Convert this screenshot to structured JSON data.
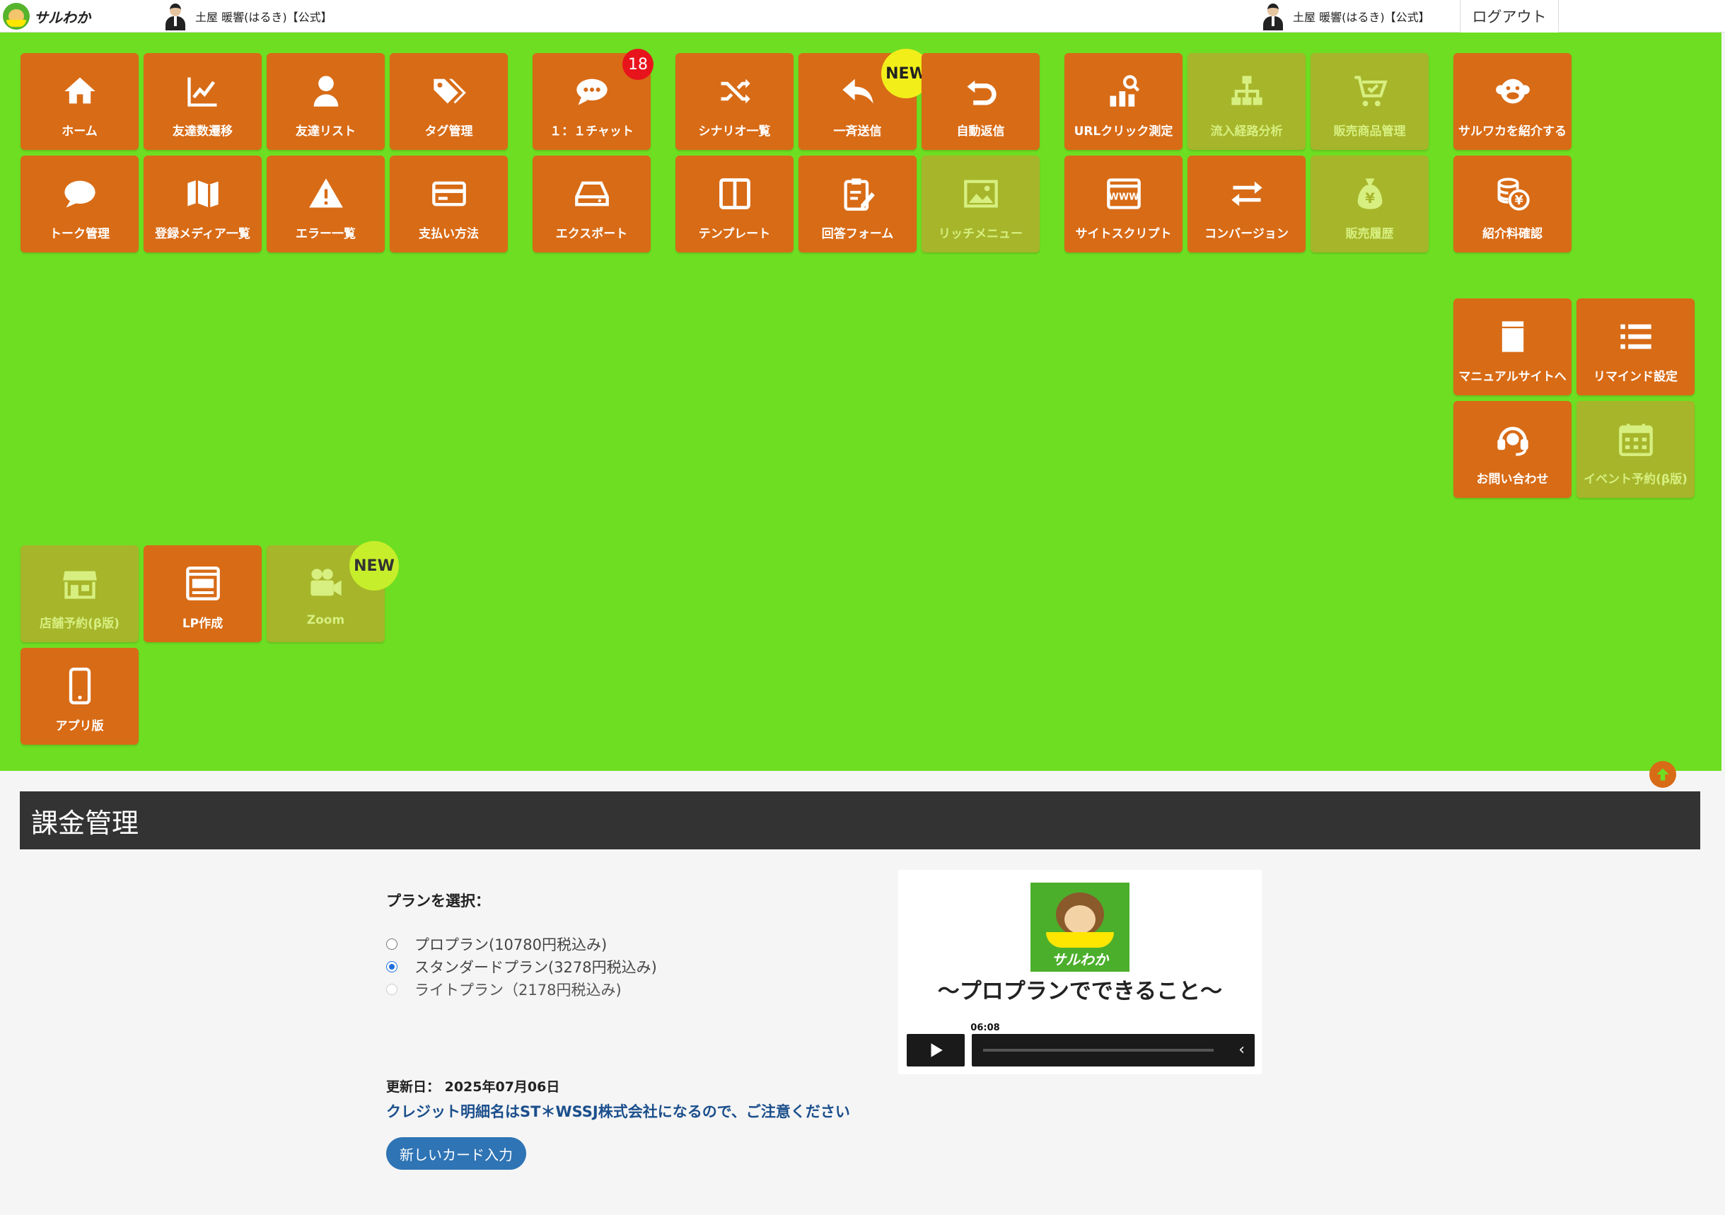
{
  "header": {
    "logo_text": "サルわか",
    "account_left": "土屋 暖響(はるき)【公式】",
    "account_right": "土屋 暖響(はるき)【公式】",
    "logout_label": "ログアウト"
  },
  "tiles": {
    "home": "ホーム",
    "friend_trend": "友達数遷移",
    "friend_list": "友達リスト",
    "tag_manage": "タグ管理",
    "chat": "１：１チャット",
    "chat_badge": "18",
    "scenario_list": "シナリオ一覧",
    "broadcast": "一斉送信",
    "broadcast_badge": "NEW",
    "auto_reply": "自動返信",
    "url_click": "URLクリック測定",
    "inflow_analysis": "流入経路分析",
    "product_manage": "販売商品管理",
    "introduce": "サルワカを紹介する",
    "talk_manage": "トーク管理",
    "media_list": "登録メディア一覧",
    "error_list": "エラー一覧",
    "payment_method": "支払い方法",
    "export": "エクスポート",
    "template": "テンプレート",
    "answer_form": "回答フォーム",
    "rich_menu": "リッチメニュー",
    "site_script": "サイトスクリプト",
    "conversion": "コンバージョン",
    "sales_history": "販売履歴",
    "referral_fee": "紹介料確認",
    "manual_site": "マニュアルサイトへ",
    "remind_setting": "リマインド設定",
    "contact": "お問い合わせ",
    "event_reserve": "イベント予約(β版)",
    "store_reserve": "店舗予約(β版)",
    "lp_create": "LP作成",
    "zoom": "Zoom",
    "zoom_badge": "NEW",
    "app_version": "アプリ版"
  },
  "billing": {
    "title": "課金管理",
    "plan_label": "プランを選択：",
    "plans": [
      {
        "label": "プロプラン(10780円税込み)",
        "selected": false
      },
      {
        "label": "スタンダードプラン(3278円税込み)",
        "selected": true
      },
      {
        "label": "ライトプラン（2178円税込み)",
        "selected": false
      }
    ],
    "updated": "更新日： 2025年07月06日",
    "notice": "クレジット明細名はST＊WSSJ株式会社になるので、ご注意ください",
    "new_card_label": "新しいカード入力"
  },
  "video": {
    "brand": "サルわか",
    "title": "〜プロプランでできること〜",
    "time": "06:08"
  },
  "colors": {
    "panel_green": "#6ede22",
    "tile_orange": "#d86b16",
    "tile_disabled": "#a6b52a",
    "badge_red": "#e8141c",
    "badge_yellow": "#f2ee1a",
    "header_dark": "#333333",
    "link_blue": "#1b4f8c",
    "button_blue": "#2f74b5"
  }
}
